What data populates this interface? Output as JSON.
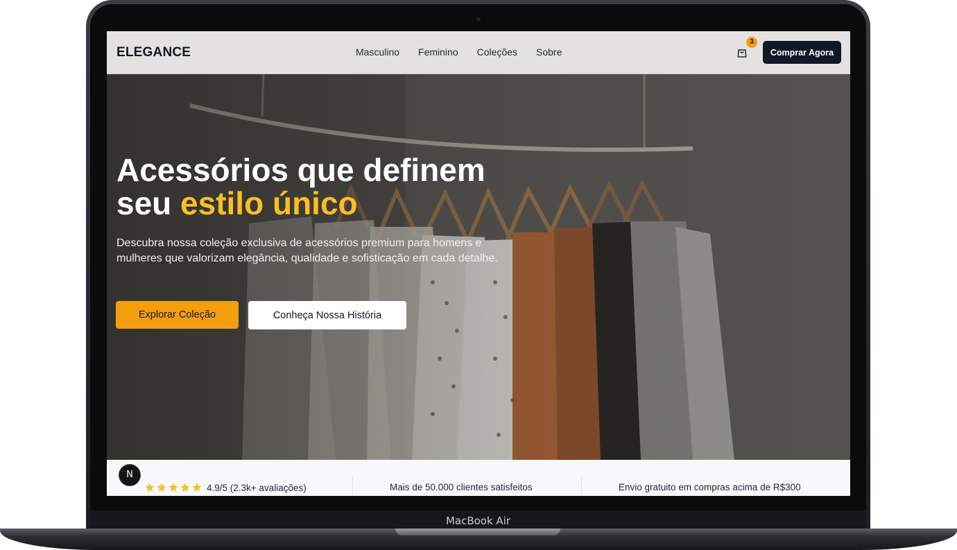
{
  "device": {
    "label": "MacBook Air"
  },
  "nav": {
    "logo": "ELEGANCE",
    "links": [
      "Masculino",
      "Feminino",
      "Coleções",
      "Sobre"
    ],
    "cart_count": "3",
    "cart_icon": "shopping-bag-icon",
    "cta": "Comprar Agora"
  },
  "hero": {
    "title_line1": "Acessórios que definem",
    "title_line2_plain": "seu ",
    "title_line2_accent": "estilo único",
    "subtitle": "Descubra nossa coleção exclusiva de acessórios premium para homens e mulheres que valorizam elegância, qualidade e sofisticação em cada detalhe.",
    "primary_button": "Explorar Coleção",
    "secondary_button": "Conheça Nossa História"
  },
  "stats": {
    "rating_text": "4.9/5 (2.3k+ avaliações)",
    "star_count": 5,
    "customers": "Mais de 50.000 clientes satisfeitos",
    "shipping": "Envio gratuito em compras acima de R$300"
  },
  "dev_badge": {
    "letter": "N",
    "icon": "nextjs-icon"
  },
  "colors": {
    "accent": "#f59e0b",
    "accent_text": "#fbbf24",
    "dark_button": "#111827",
    "nav_background": "#e3e2e0",
    "stats_background": "#f7f8fa"
  }
}
